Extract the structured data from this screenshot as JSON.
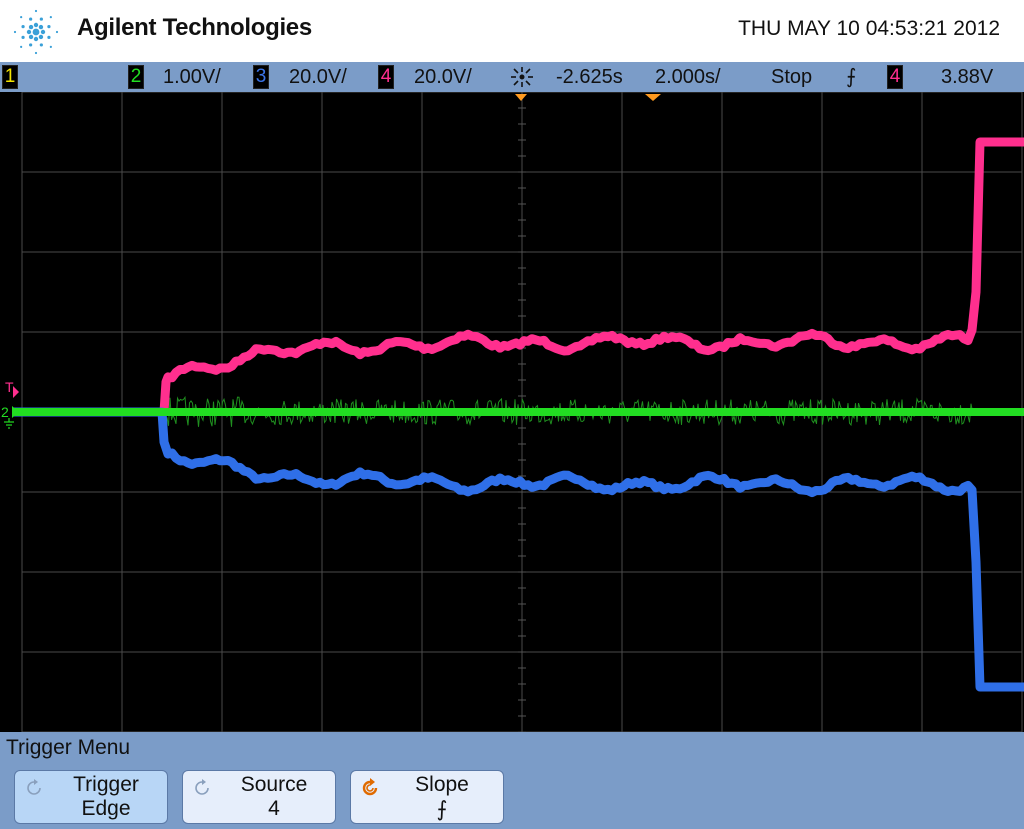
{
  "header": {
    "brand": "Agilent Technologies",
    "datetime": "THU MAY 10 04:53:21 2012"
  },
  "status": {
    "ch1": "1",
    "ch2": "2",
    "ch2_scale": "1.00V/",
    "ch3": "3",
    "ch3_scale": "20.0V/",
    "ch4": "4",
    "ch4_scale": "20.0V/",
    "time_delay": "-2.625s",
    "time_scale": "2.000s/",
    "run_state": "Stop",
    "slope_symbol": "⨍",
    "trigger_source": "4",
    "trigger_level": "3.88V"
  },
  "screen": {
    "trigger_marker": "T",
    "ch2_marker": "2"
  },
  "menu": {
    "title": "Trigger Menu",
    "softkeys": [
      {
        "label": "Trigger",
        "value": "Edge"
      },
      {
        "label": "Source",
        "value": "4"
      },
      {
        "label": "Slope",
        "value": "⨍"
      }
    ]
  },
  "colors": {
    "ch1": "#f5e400",
    "ch2": "#22dd22",
    "ch3": "#2f6fe8",
    "ch4": "#ff2f8e",
    "grid": "#555555",
    "menu_bg": "#7b9cc8"
  }
}
